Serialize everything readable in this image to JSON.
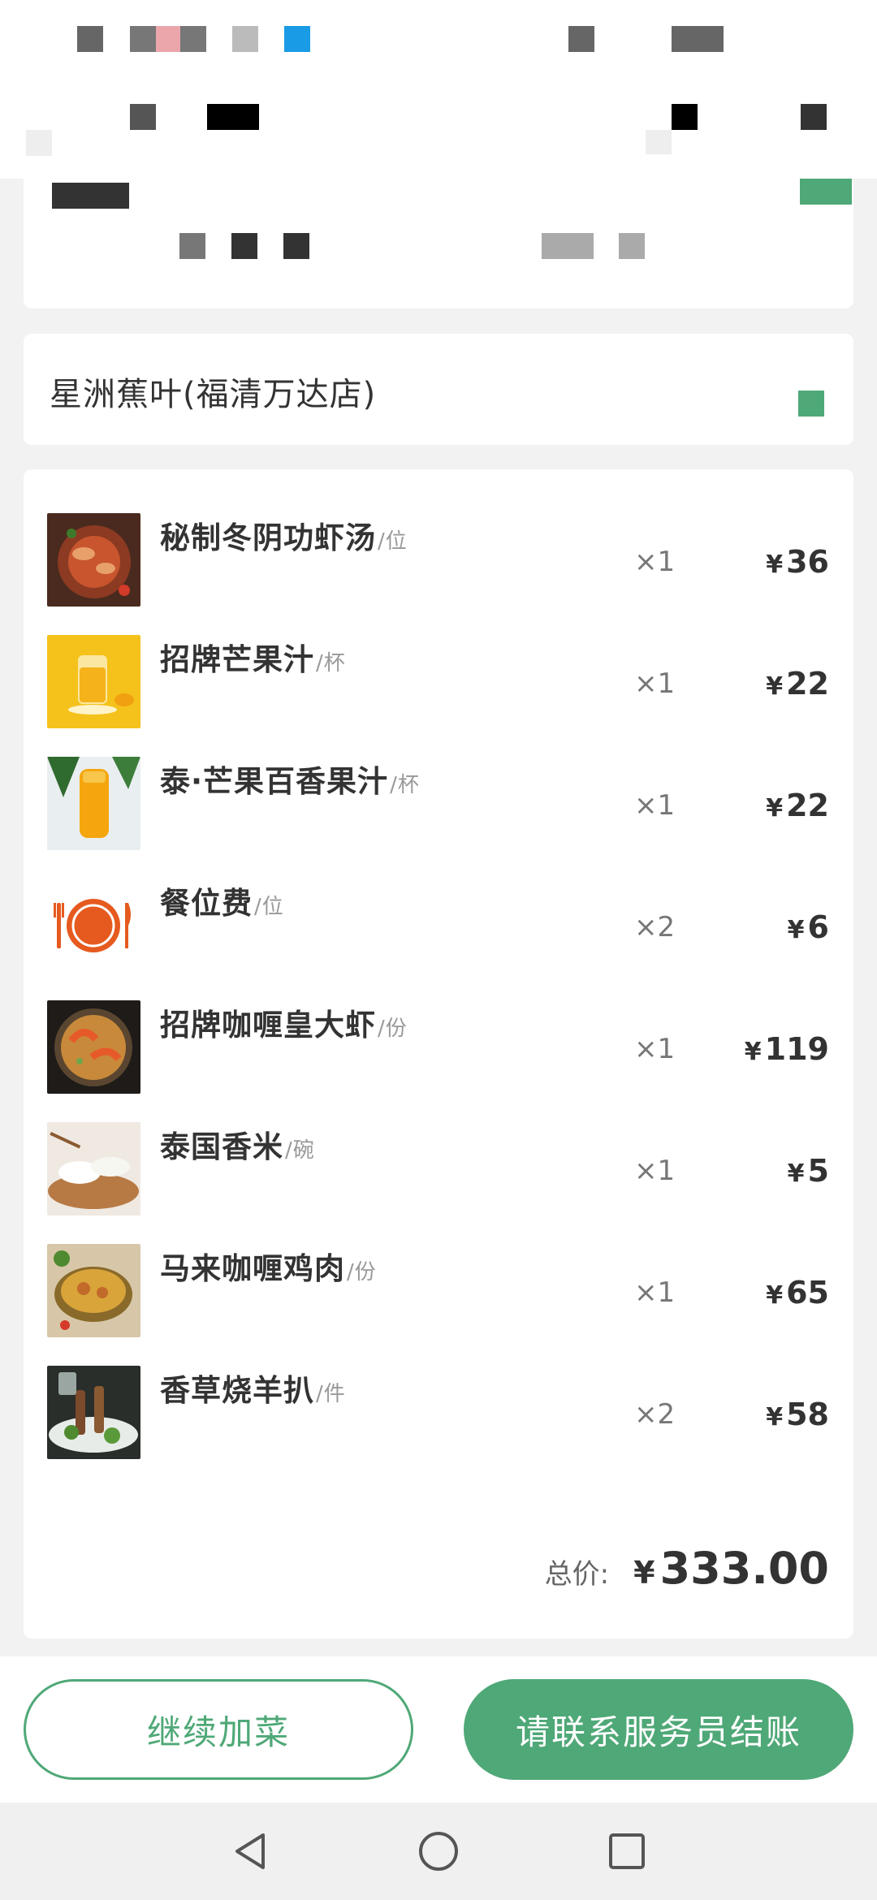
{
  "store": {
    "name": "星洲蕉叶(福清万达店)"
  },
  "order": {
    "items": [
      {
        "name": "秘制冬阴功虾汤",
        "unit": "/位",
        "qty": "×1",
        "price": "36",
        "icon": "tom-yum-soup-image"
      },
      {
        "name": "招牌芒果汁",
        "unit": "/杯",
        "qty": "×1",
        "price": "22",
        "icon": "mango-juice-image"
      },
      {
        "name": "泰·芒果百香果汁",
        "unit": "/杯",
        "qty": "×1",
        "price": "22",
        "icon": "mango-passion-juice-image"
      },
      {
        "name": "餐位费",
        "unit": "/位",
        "qty": "×2",
        "price": "6",
        "icon": "plate-cutlery-icon"
      },
      {
        "name": "招牌咖喱皇大虾",
        "unit": "/份",
        "qty": "×1",
        "price": "119",
        "icon": "curry-prawn-image"
      },
      {
        "name": "泰国香米",
        "unit": "/碗",
        "qty": "×1",
        "price": "5",
        "icon": "rice-bowl-image"
      },
      {
        "name": "马来咖喱鸡肉",
        "unit": "/份",
        "qty": "×1",
        "price": "65",
        "icon": "curry-chicken-image"
      },
      {
        "name": "香草烧羊扒",
        "unit": "/件",
        "qty": "×2",
        "price": "58",
        "icon": "lamb-chop-image"
      }
    ],
    "currency": "¥",
    "total_label": "总价:",
    "total_value": "333.00"
  },
  "actions": {
    "add_more_label": "继续加菜",
    "checkout_label": "请联系服务员结账"
  },
  "colors": {
    "accent": "#4fa877",
    "background": "#f2f2f2"
  },
  "system_nav": {
    "back_icon": "triangle-back-icon",
    "home_icon": "circle-home-icon",
    "recents_icon": "square-recents-icon"
  }
}
